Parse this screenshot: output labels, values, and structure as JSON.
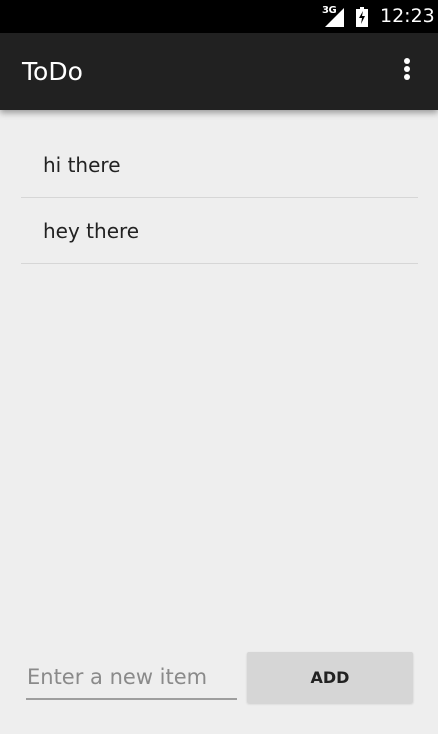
{
  "status_bar": {
    "network_label": "3G",
    "time": "12:23",
    "signal_icon": "signal-icon",
    "battery_icon": "battery-charging-icon"
  },
  "app_bar": {
    "title": "ToDo",
    "overflow_icon": "more-vert-icon"
  },
  "todo_list": {
    "items": [
      {
        "label": "hi there"
      },
      {
        "label": "hey there"
      }
    ]
  },
  "input_area": {
    "placeholder": "Enter a new item",
    "value": "",
    "add_label": "ADD"
  },
  "colors": {
    "status_bar": "#000000",
    "app_bar": "#212121",
    "background": "#eeeeee",
    "button": "#d6d6d6"
  }
}
